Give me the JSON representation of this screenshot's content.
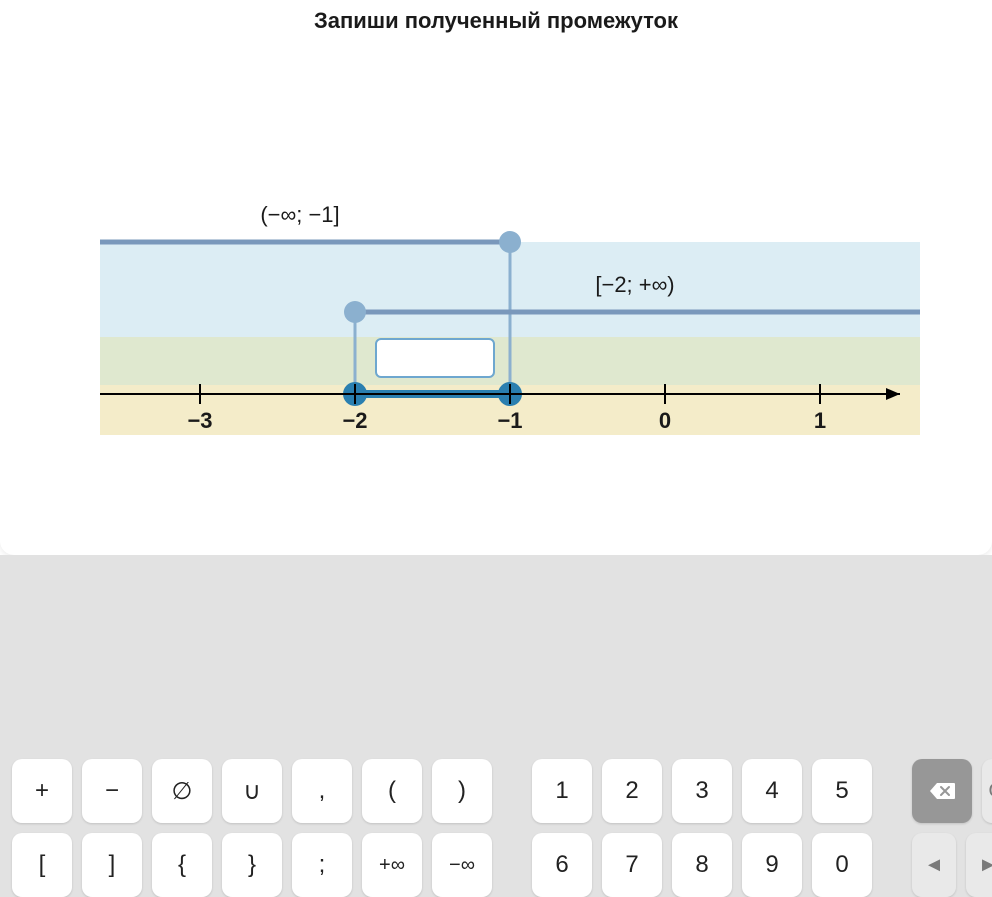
{
  "title": "Запиши полученный промежуток",
  "intervals": {
    "left_label": "(−∞; −1]",
    "right_label": "[−2; +∞)"
  },
  "axis_ticks": [
    "−3",
    "−2",
    "−1",
    "0",
    "1"
  ],
  "answer_input": "",
  "keyboard": {
    "row1_sym": [
      "+",
      "−",
      "∅",
      "∪",
      ",",
      "(",
      ")"
    ],
    "row1_num": [
      "1",
      "2",
      "3",
      "4",
      "5"
    ],
    "row2_sym": [
      "[",
      "]",
      "{",
      "}",
      ";",
      "+∞",
      "−∞"
    ],
    "row2_num": [
      "6",
      "7",
      "8",
      "9",
      "0"
    ],
    "ok": "OK",
    "nav_left": "◄",
    "nav_right": "►"
  },
  "chart_data": {
    "type": "numberline-intervals",
    "title": "Запиши полученный промежуток",
    "x_ticks": [
      -3,
      -2,
      -1,
      0,
      1
    ],
    "intervals": [
      {
        "label": "(−∞; −1]",
        "start": "-inf",
        "end": -1,
        "start_closed": false,
        "end_closed": true
      },
      {
        "label": "[−2; +∞)",
        "start": -2,
        "end": "+inf",
        "start_closed": true,
        "end_closed": false
      }
    ],
    "intersection": {
      "start": -2,
      "end": -1,
      "start_closed": true,
      "end_closed": true
    },
    "axis_range": [
      -3.6,
      1.6
    ]
  }
}
